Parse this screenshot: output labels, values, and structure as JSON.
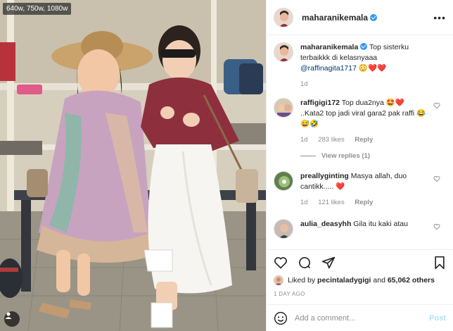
{
  "image_badge": "640w, 750w, 1080w",
  "post": {
    "username": "maharanikemala",
    "more_label": "•••"
  },
  "caption": {
    "username": "maharanikemala",
    "text": "Top sisterku terbaikkk di kelasnyaaa",
    "mention": "@raffinagita1717",
    "emoji": "😳❤️❤️",
    "time": "1d"
  },
  "comments": [
    {
      "username": "raffigigi172",
      "text": "Top dua2nya 🤩❤️ ..Kata2 top jadi viral gara2 pak raffi 😂😅🤣",
      "time": "1d",
      "likes": "283 likes",
      "reply": "Reply",
      "view_replies": "View replies (1)"
    },
    {
      "username": "preallyginting",
      "text": "Masya allah, duo cantikk..... ❤️",
      "time": "1d",
      "likes": "121 likes",
      "reply": "Reply"
    },
    {
      "username": "aulia_deasyhh",
      "text": "Gila itu kaki atau"
    }
  ],
  "actions": {
    "liked_prefix": "Liked by",
    "liked_user": "pecintaladygigi",
    "liked_and": "and",
    "liked_others": "65,062 others",
    "time_ago": "1 DAY AGO"
  },
  "composer": {
    "placeholder": "Add a comment...",
    "post_label": "Post"
  },
  "colors": {
    "link_blue": "#00376b",
    "verified_blue": "#3897f0",
    "heart_red": "#ed4956",
    "post_disabled": "#b2dffc"
  }
}
